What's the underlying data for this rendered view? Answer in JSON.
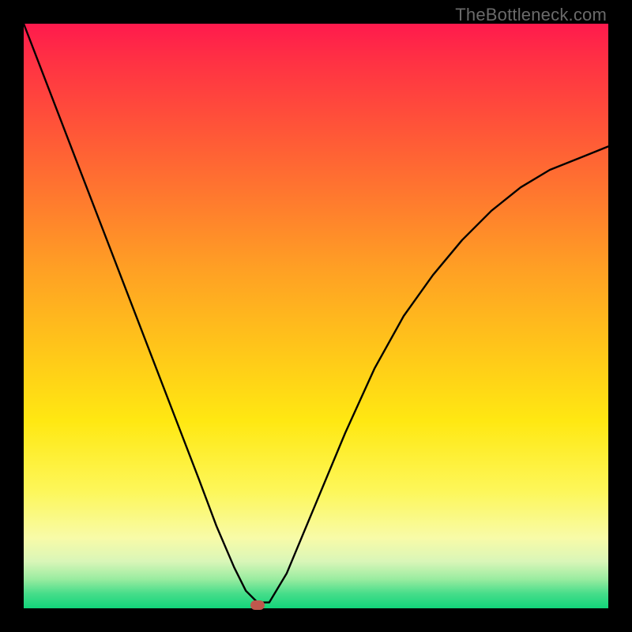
{
  "watermark": "TheBottleneck.com",
  "chart_data": {
    "type": "line",
    "title": "",
    "xlabel": "",
    "ylabel": "",
    "xlim": [
      0,
      100
    ],
    "ylim": [
      0,
      100
    ],
    "grid": false,
    "legend": false,
    "series": [
      {
        "name": "bottleneck-curve",
        "x": [
          0,
          5,
          10,
          15,
          20,
          25,
          30,
          33,
          36,
          38,
          40,
          42,
          45,
          50,
          55,
          60,
          65,
          70,
          75,
          80,
          85,
          90,
          95,
          100
        ],
        "values": [
          100,
          87,
          74,
          61,
          48,
          35,
          22,
          14,
          7,
          3,
          1,
          1,
          6,
          18,
          30,
          41,
          50,
          57,
          63,
          68,
          72,
          75,
          77,
          79
        ]
      }
    ],
    "marker": {
      "x": 40,
      "y": 0.5
    },
    "gradient_colors": {
      "top": "#ff1a4d",
      "mid_upper": "#ff7a2e",
      "mid": "#ffe812",
      "mid_lower": "#f8fba8",
      "bottom": "#12d47a"
    }
  }
}
